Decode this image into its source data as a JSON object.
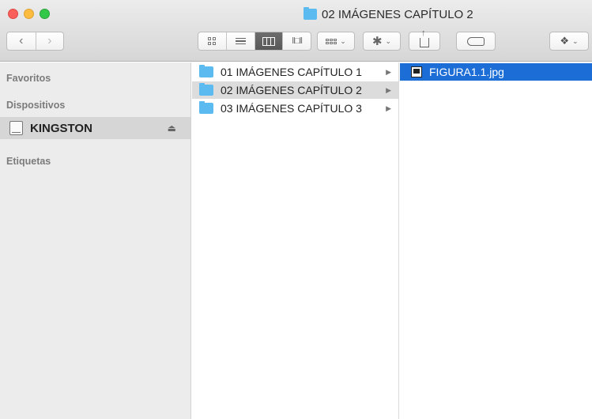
{
  "window": {
    "title": "02 IMÁGENES CAPÍTULO 2",
    "title_icon": "folder-icon"
  },
  "toolbar": {
    "back_icon": "‹",
    "forward_icon": "›",
    "view_modes": [
      "icons",
      "list",
      "columns",
      "cover-flow"
    ],
    "active_view": "columns",
    "arrange_caret": "⌄",
    "action_caret": "⌄",
    "dropbox_caret": "⌄"
  },
  "sidebar": {
    "favorites_header": "Favoritos",
    "devices_header": "Dispositivos",
    "devices": [
      {
        "label": "KINGSTON",
        "icon": "drive-icon",
        "eject": "⏏"
      }
    ],
    "tags_header": "Etiquetas"
  },
  "columns": {
    "col1": [
      {
        "label": "01 IMÁGENES CAPÍTULO 1",
        "arrow": "▶",
        "selected": false
      },
      {
        "label": "02 IMÁGENES CAPÍTULO 2",
        "arrow": "▶",
        "selected": true
      },
      {
        "label": "03 IMÁGENES CAPÍTULO 3",
        "arrow": "▶",
        "selected": false
      }
    ],
    "col2": [
      {
        "label": "FIGURA1.1.jpg",
        "icon": "image-file-icon",
        "selected": true
      }
    ]
  },
  "colors": {
    "folder": "#5bbaf0",
    "selection_blue": "#1c6ed6",
    "selection_gray": "#dcdcdc",
    "sidebar_bg": "#ececec"
  }
}
